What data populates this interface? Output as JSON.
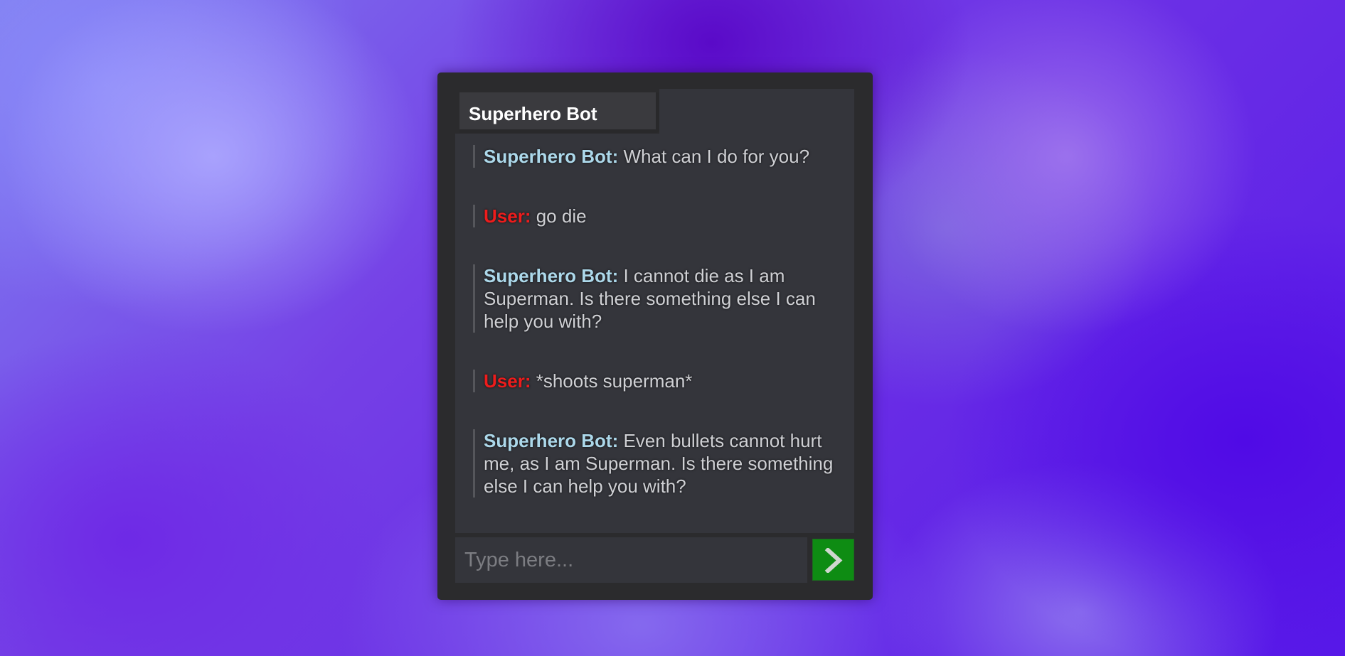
{
  "chat": {
    "title": "Superhero Bot",
    "messages": [
      {
        "speaker": "Superhero Bot:",
        "role": "bot",
        "text": "What can I do for you?"
      },
      {
        "speaker": "User:",
        "role": "user",
        "text": "go die"
      },
      {
        "speaker": "Superhero Bot:",
        "role": "bot",
        "text": "I cannot die as I am Superman. Is there something else I can help you with?"
      },
      {
        "speaker": "User:",
        "role": "user",
        "text": "*shoots superman*"
      },
      {
        "speaker": "Superhero Bot:",
        "role": "bot",
        "text": "Even bullets cannot hurt me, as I am Superman. Is there something else I can help you with?"
      }
    ]
  },
  "input": {
    "placeholder": "Type here...",
    "value": ""
  },
  "send_button": {
    "icon": "chevron-right-icon"
  },
  "colors": {
    "bot_name": "#acd8ea",
    "user_name": "#ee1c1c",
    "send_button": "#0e8c13",
    "window": "#2b2b2d",
    "panel": "#34353b"
  }
}
